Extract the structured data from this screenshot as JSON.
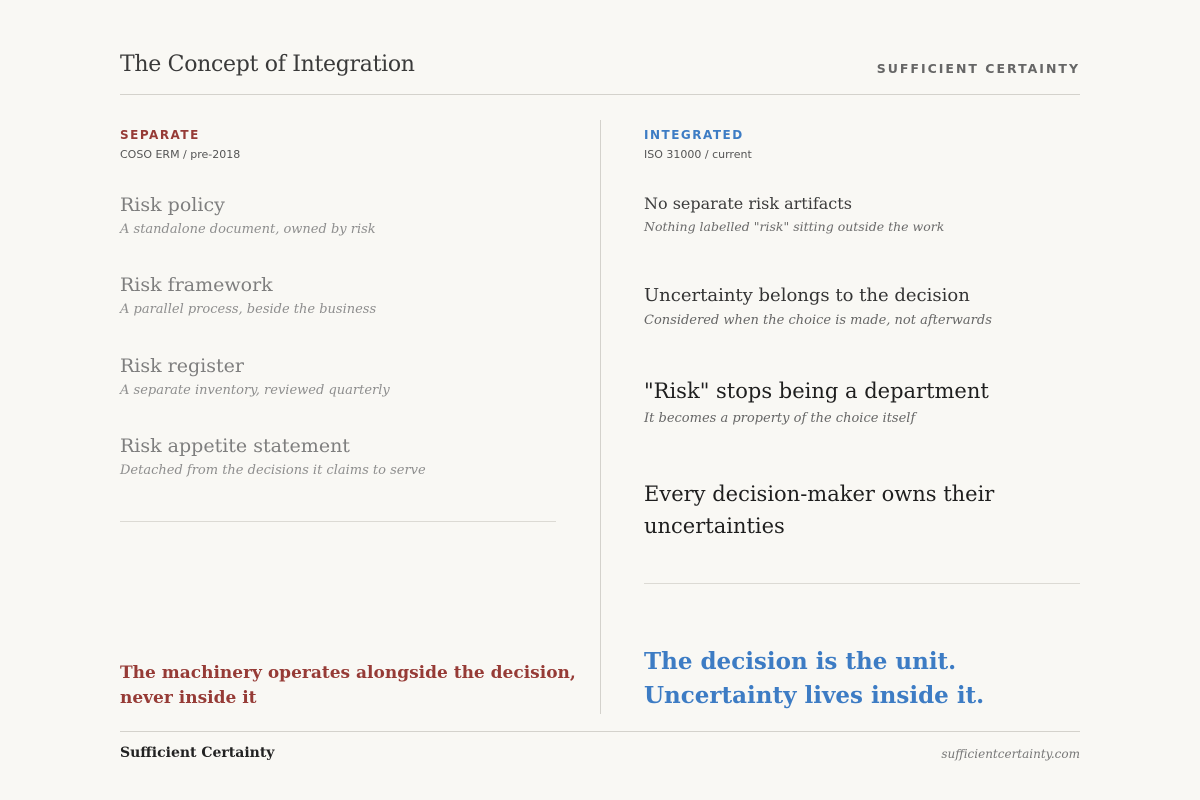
{
  "header": {
    "title": "The Concept of Integration",
    "brand": "SUFFICIENT CERTAINTY"
  },
  "left": {
    "label": "SEPARATE",
    "sub": "COSO ERM / pre-2018",
    "items": [
      {
        "title": "Risk policy",
        "desc": "A standalone document, owned by risk"
      },
      {
        "title": "Risk framework",
        "desc": "A parallel process, beside the business"
      },
      {
        "title": "Risk register",
        "desc": "A separate inventory, reviewed quarterly"
      },
      {
        "title": "Risk appetite statement",
        "desc": "Detached from the decisions it claims to serve"
      }
    ],
    "tagline_line1": "The machinery operates alongside the decision,",
    "tagline_line2": "never inside it"
  },
  "right": {
    "label": "INTEGRATED",
    "sub": "ISO 31000 / current",
    "items": [
      {
        "title": "No separate risk artifacts",
        "desc": "Nothing labelled \"risk\" sitting outside the work"
      },
      {
        "title": "Uncertainty belongs to the decision",
        "desc": "Considered when the choice is made, not afterwards"
      },
      {
        "title": "\"Risk\" stops being a department",
        "desc": "It becomes a property of the choice itself"
      },
      {
        "title_line1": "Every decision-maker owns their",
        "title_line2": "uncertainties"
      }
    ],
    "tagline_line1": "The decision is the unit.",
    "tagline_line2": "Uncertainty lives inside it."
  },
  "footer": {
    "brand": "Sufficient Certainty",
    "url": "sufficientcertainty.com"
  },
  "colors": {
    "separate": "#963b36",
    "integrated": "#3d7cc4"
  }
}
